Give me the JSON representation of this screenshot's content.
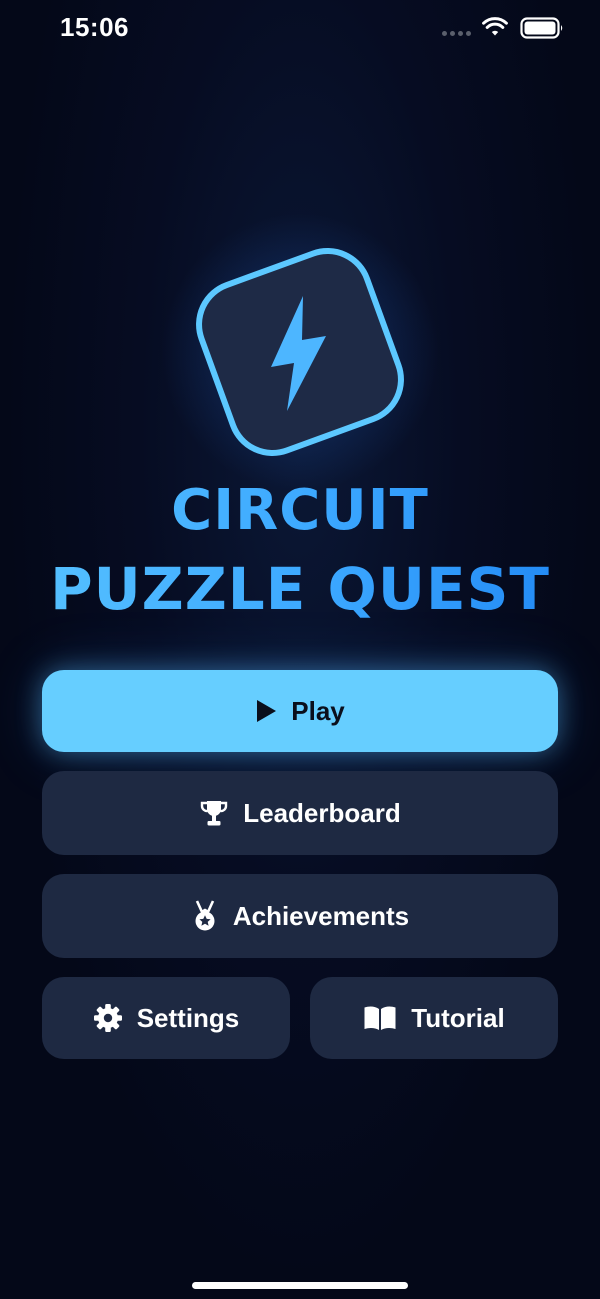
{
  "status_bar": {
    "time": "15:06",
    "icons": [
      "cellular-dots-icon",
      "wifi-icon",
      "battery-icon"
    ]
  },
  "logo": {
    "icon": "lightning-bolt-icon",
    "accent_color": "#5cc8ff"
  },
  "title": {
    "line1": "CIRCUIT",
    "line2": "PUZZLE QUEST",
    "gradient": [
      "#58c3ff",
      "#1f86f3"
    ]
  },
  "menu": {
    "play": {
      "label": "Play",
      "icon": "play-icon",
      "color": "#66ceff"
    },
    "leaderboard": {
      "label": "Leaderboard",
      "icon": "trophy-icon"
    },
    "achievements": {
      "label": "Achievements",
      "icon": "medal-icon"
    },
    "settings": {
      "label": "Settings",
      "icon": "gear-icon"
    },
    "tutorial": {
      "label": "Tutorial",
      "icon": "book-icon"
    }
  },
  "colors": {
    "background": "#050a1c",
    "button": "#1e2942",
    "primary": "#66ceff"
  }
}
